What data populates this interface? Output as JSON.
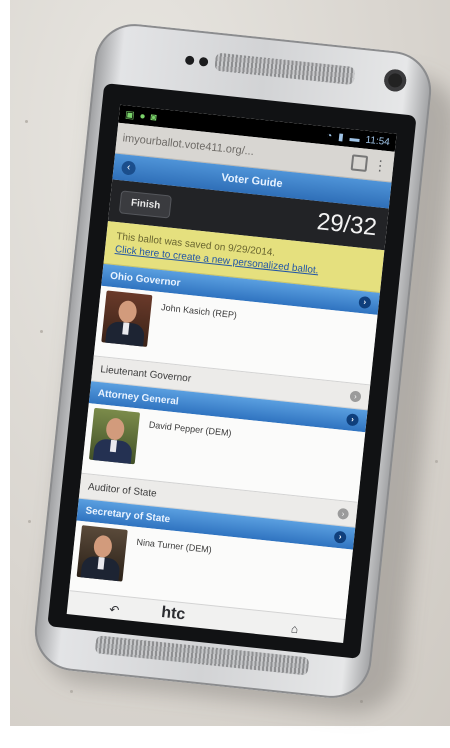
{
  "status_bar": {
    "time": "11:54"
  },
  "browser": {
    "url": "imyourballot.vote411.org/..."
  },
  "app_bar": {
    "title": "Voter Guide",
    "back_icon": "chevron-left-icon"
  },
  "toolbar": {
    "finish_label": "Finish",
    "counter": "29/32"
  },
  "notice": {
    "text": "This ballot was saved on 9/29/2014.",
    "link": "Click here to create a new personalized ballot."
  },
  "races": [
    {
      "header": "Ohio Governor",
      "candidate": "John Kasich (REP)"
    },
    {
      "plain": "Lieutenant Governor"
    },
    {
      "header": "Attorney General",
      "candidate": "David Pepper (DEM)"
    },
    {
      "plain": "Auditor of State"
    },
    {
      "header": "Secretary of State",
      "candidate": "Nina Turner (DEM)"
    }
  ],
  "hardware": {
    "brand": "htc"
  }
}
